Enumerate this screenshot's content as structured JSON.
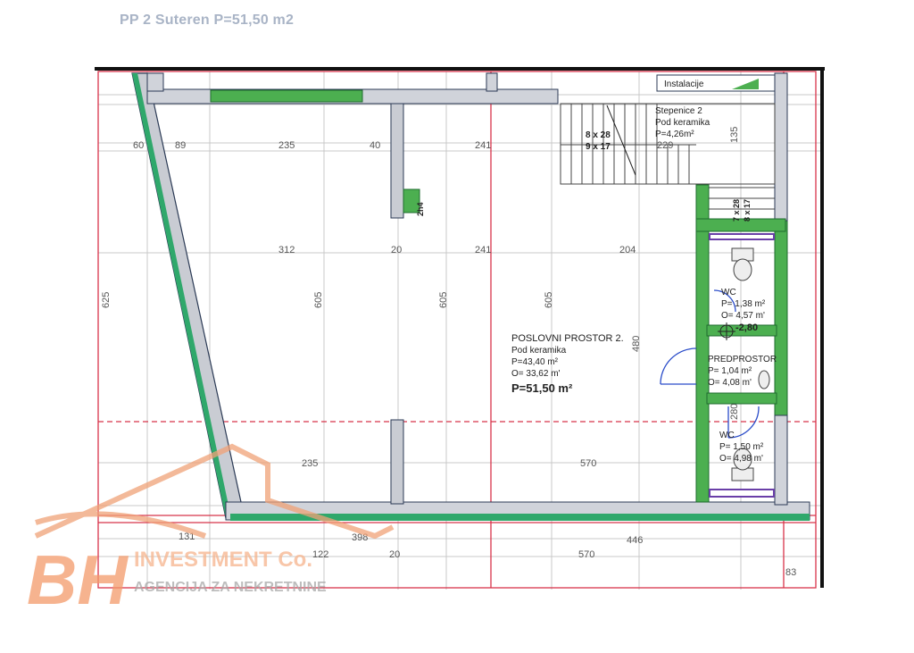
{
  "title": "PP 2 Suteren P=51,50 m2",
  "rooms": {
    "main": {
      "name": "POSLOVNI PROSTOR 2.",
      "floor": "Pod keramika",
      "p": "P=43,40 m²",
      "o": "O= 33,62 m'",
      "total": "P=51,50 m²"
    },
    "stairs": {
      "name": "Stepenice 2",
      "floor": "Pod keramika",
      "p": "P=4,26m²",
      "steps_a1": "8 x 28",
      "steps_a2": "9 x 17",
      "steps_b1": "7 x 28",
      "steps_b2": "8 x 17"
    },
    "wc1": {
      "name": "WC",
      "p": "P= 1,38 m²",
      "o": "O= 4,57 m'"
    },
    "hall": {
      "name": "PREDPROSTOR",
      "p": "P= 1,04 m²",
      "o": "O= 4,08 m'"
    },
    "wc2": {
      "name": "WC",
      "p": "P= 1,50 m²",
      "o": "O= 4,98 m'"
    },
    "instalacije": "Instalacije",
    "level": "-2,80",
    "column_tag": "2h4"
  },
  "dimensions": {
    "d89": "89",
    "d235a": "235",
    "d40": "40",
    "d241a": "241",
    "d312": "312",
    "d20a": "20",
    "d241b": "241",
    "d204": "204",
    "d605a": "605",
    "d605b": "605",
    "d605c": "605",
    "d480": "480",
    "d625": "625",
    "d235b": "235",
    "d570a": "570",
    "d131": "131",
    "d398": "398",
    "d446": "446",
    "d122": "122",
    "d20b": "20",
    "d570b": "570",
    "d83": "83",
    "d135": "135",
    "d229": "229",
    "d60": "60",
    "d280": "280"
  },
  "watermark": {
    "logo": "BH",
    "company": "INVESTMENT Co.",
    "tagline": "AGENCIJA ZA NEKRETNINE"
  }
}
